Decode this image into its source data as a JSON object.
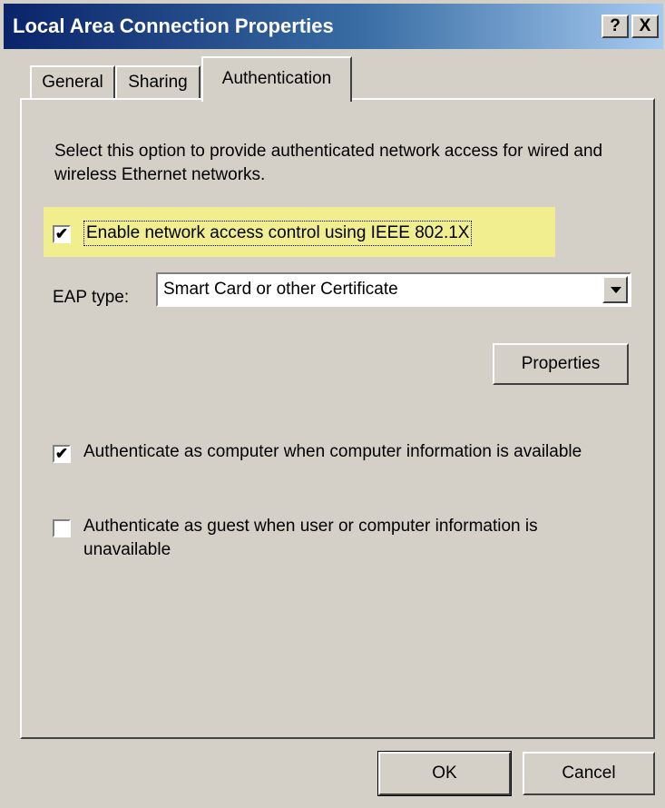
{
  "window": {
    "title": "Local Area Connection Properties",
    "help_button": "?",
    "close_button": "X"
  },
  "tabs": [
    {
      "label": "General",
      "active": false
    },
    {
      "label": "Sharing",
      "active": false
    },
    {
      "label": "Authentication",
      "active": true
    }
  ],
  "authentication": {
    "description": "Select this option to provide authenticated network access for wired and wireless Ethernet networks.",
    "enable_8021x": {
      "checked": true,
      "label": "Enable network access control using IEEE 802.1X"
    },
    "eap_type": {
      "label": "EAP type:",
      "value": "Smart Card or other Certificate"
    },
    "properties_button": "Properties",
    "auth_as_computer": {
      "checked": true,
      "label": "Authenticate as computer when computer information is available"
    },
    "auth_as_guest": {
      "checked": false,
      "label": "Authenticate as guest when user or computer information is unavailable"
    }
  },
  "footer": {
    "ok_label": "OK",
    "cancel_label": "Cancel"
  },
  "colors": {
    "highlight": "#f0ee8e",
    "titlebar_start": "#0a246a",
    "titlebar_end": "#a6caf0",
    "face": "#d4d0c8"
  }
}
